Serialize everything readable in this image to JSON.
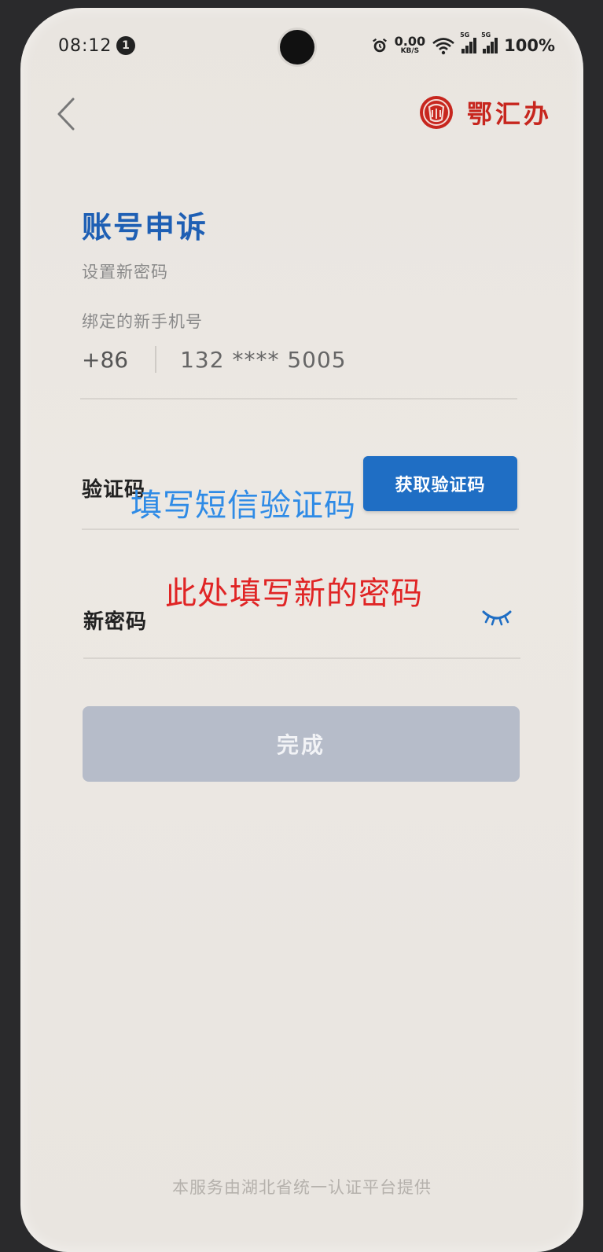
{
  "status_bar": {
    "time": "08:12",
    "notification_count": "1",
    "net_speed_value": "0.00",
    "net_speed_unit": "KB/S",
    "signal1_tag": "5G",
    "signal2_tag": "5G",
    "battery": "100%"
  },
  "nav": {
    "brand_name": "鄂汇办"
  },
  "page": {
    "title": "账号申诉",
    "subtitle": "设置新密码"
  },
  "phone_binding": {
    "label": "绑定的新手机号",
    "country_code": "+86",
    "number": "132 **** 5005"
  },
  "code_field": {
    "label": "验证码",
    "hint": "填写短信验证码",
    "get_code_label": "获取验证码"
  },
  "password_field": {
    "label": "新密码",
    "hint": "此处填写新的密码"
  },
  "submit_label": "完成",
  "footer": "本服务由湖北省统一认证平台提供",
  "colors": {
    "accent": "#1f6ec4",
    "title": "#1e5fb4",
    "brand": "#c7261e",
    "annotation_blue": "#2f8be6",
    "annotation_red": "#e02525",
    "disabled_button": "#b6bcc9"
  },
  "icons": [
    "back-arrow-icon",
    "brand-logo-icon",
    "eye-closed-icon",
    "alarm-icon",
    "wifi-icon",
    "signal-icon"
  ]
}
